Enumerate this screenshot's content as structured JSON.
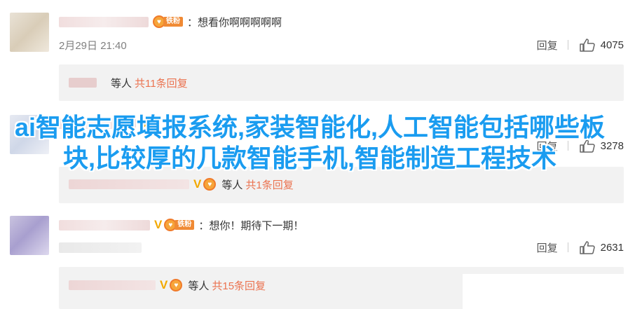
{
  "comments": [
    {
      "text": "：想看你啊啊啊啊啊",
      "fan_label": "铁粉",
      "time": "2月29日 21:40",
      "reply_label": "回复",
      "likes": "4075",
      "sub": {
        "deng": "等人",
        "count_text": "共11条回复"
      }
    },
    {
      "reply_label": "回复",
      "likes": "3278",
      "sub": {
        "deng": "等人",
        "count_text": "共1条回复"
      }
    },
    {
      "text": "：想你！期待下一期！",
      "fan_label": "铁粉",
      "reply_label": "回复",
      "likes": "2631",
      "sub": {
        "deng": "等人",
        "count_text": "共15条回复"
      }
    }
  ],
  "overlay_title": "ai智能志愿填报系统,家装智能化,人工智能包括哪些板块,比较厚的几款智能手机,智能制造工程技术",
  "icons": {
    "like": "thumbs-up-icon",
    "verified": "verified-v-icon",
    "fan": "fan-badge-icon"
  },
  "colors": {
    "overlay": "#1a9cf0",
    "reply_count": "#eb7350",
    "sub_bg": "#f2f2f2"
  }
}
